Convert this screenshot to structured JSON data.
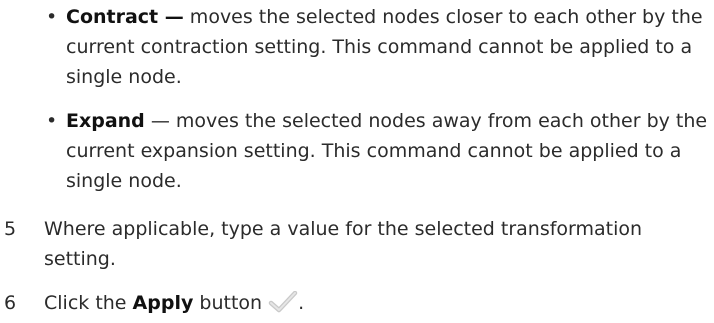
{
  "bullets": [
    {
      "term": "Contract —",
      "description": " moves the selected nodes closer to each other by the current contraction setting. This command cannot be applied to a single node."
    },
    {
      "term": "Expand",
      "description": " — moves the selected nodes away from each other by the current expansion setting. This command cannot be applied to a single node."
    }
  ],
  "steps": [
    {
      "number": "5",
      "text": "Where applicable, type a value for the selected transformation setting."
    },
    {
      "number": "6",
      "text_before": "Click the ",
      "button_label": "Apply",
      "text_after": " button",
      "text_end": ".",
      "icon": "checkmark-icon"
    }
  ],
  "colors": {
    "text": "#2b2b2b",
    "icon": "#c8c8c8"
  }
}
